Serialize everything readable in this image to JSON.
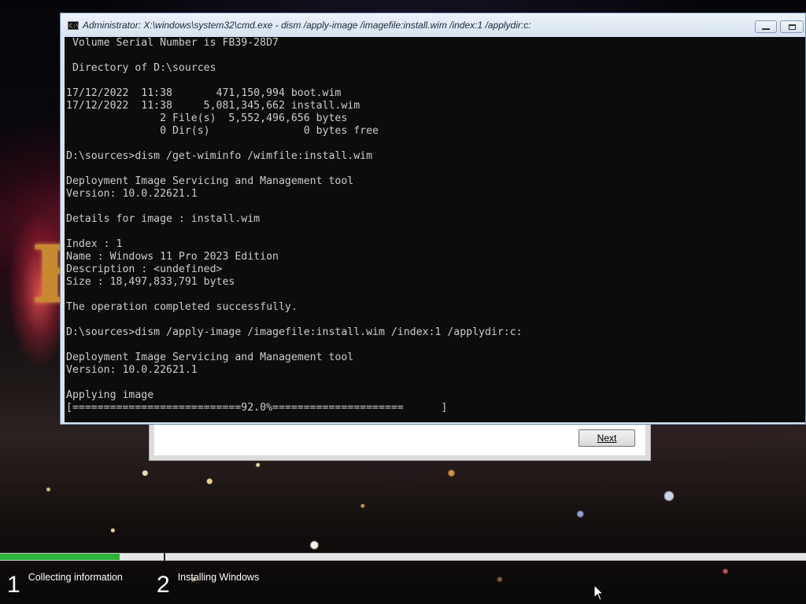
{
  "console_window": {
    "title": "Administrator: X:\\windows\\system32\\cmd.exe - dism  /apply-image /imagefile:install.wim /index:1 /applydir:c:",
    "icon_label": "C:\\",
    "lines": [
      " Volume Serial Number is FB39-28D7",
      "",
      " Directory of D:\\sources",
      "",
      "17/12/2022  11:38       471,150,994 boot.wim",
      "17/12/2022  11:38     5,081,345,662 install.wim",
      "               2 File(s)  5,552,496,656 bytes",
      "               0 Dir(s)               0 bytes free",
      "",
      "D:\\sources>dism /get-wiminfo /wimfile:install.wim",
      "",
      "Deployment Image Servicing and Management tool",
      "Version: 10.0.22621.1",
      "",
      "Details for image : install.wim",
      "",
      "Index : 1",
      "Name : Windows 11 Pro 2023 Edition",
      "Description : <undefined>",
      "Size : 18,497,833,791 bytes",
      "",
      "The operation completed successfully.",
      "",
      "D:\\sources>dism /apply-image /imagefile:install.wim /index:1 /applydir:c:",
      "",
      "Deployment Image Servicing and Management tool",
      "Version: 10.0.22621.1",
      "",
      "Applying image",
      "[===========================92.0%=====================      ]"
    ]
  },
  "setup_dialog": {
    "next_label": "Next"
  },
  "setup_progress": {
    "fraction": 0.148,
    "fill_color": "#2db33a",
    "steps": [
      {
        "number": "1",
        "label": "Collecting information"
      },
      {
        "number": "2",
        "label": "Installing Windows"
      }
    ]
  }
}
